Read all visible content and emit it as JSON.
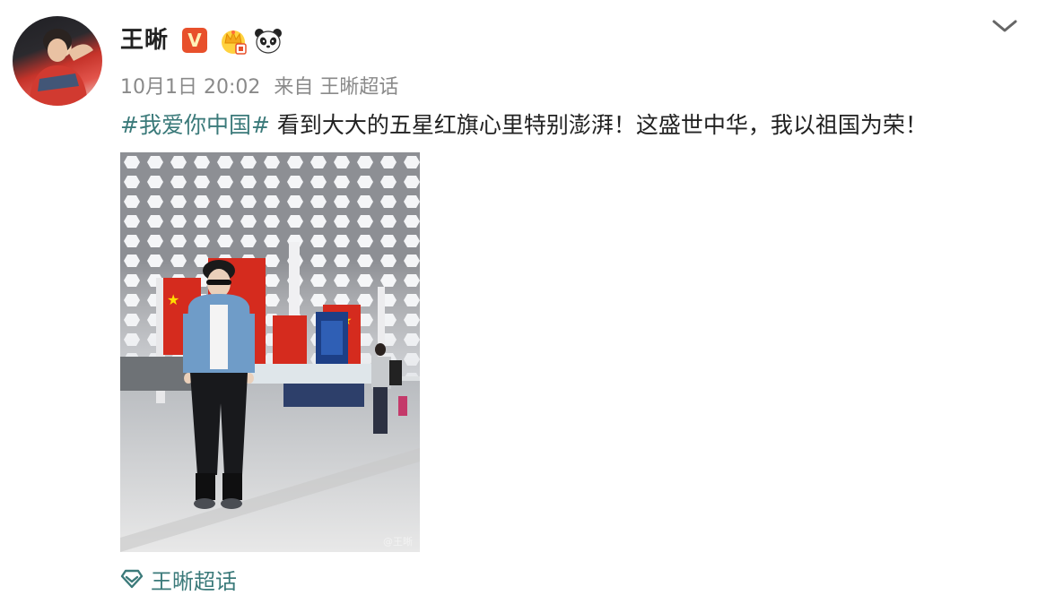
{
  "user": {
    "name": "王晰",
    "verified_badge": "V",
    "avatar_icon": "user-avatar"
  },
  "meta": {
    "time": "10月1日 20:02",
    "from_prefix": "来自",
    "source": "王晰超话"
  },
  "post": {
    "topic": "#我爱你中国#",
    "text": " 看到大大的五星红旗心里特别澎湃！这盛世中华，我以祖国为荣！"
  },
  "image": {
    "watermark": "@王晰"
  },
  "footer": {
    "supertopic_label": "王晰超话",
    "supertopic_icon": "diamond-icon"
  },
  "colors": {
    "accent": "#3b7a7a",
    "meta": "#8a8a8a",
    "verified": "#e8502b"
  }
}
